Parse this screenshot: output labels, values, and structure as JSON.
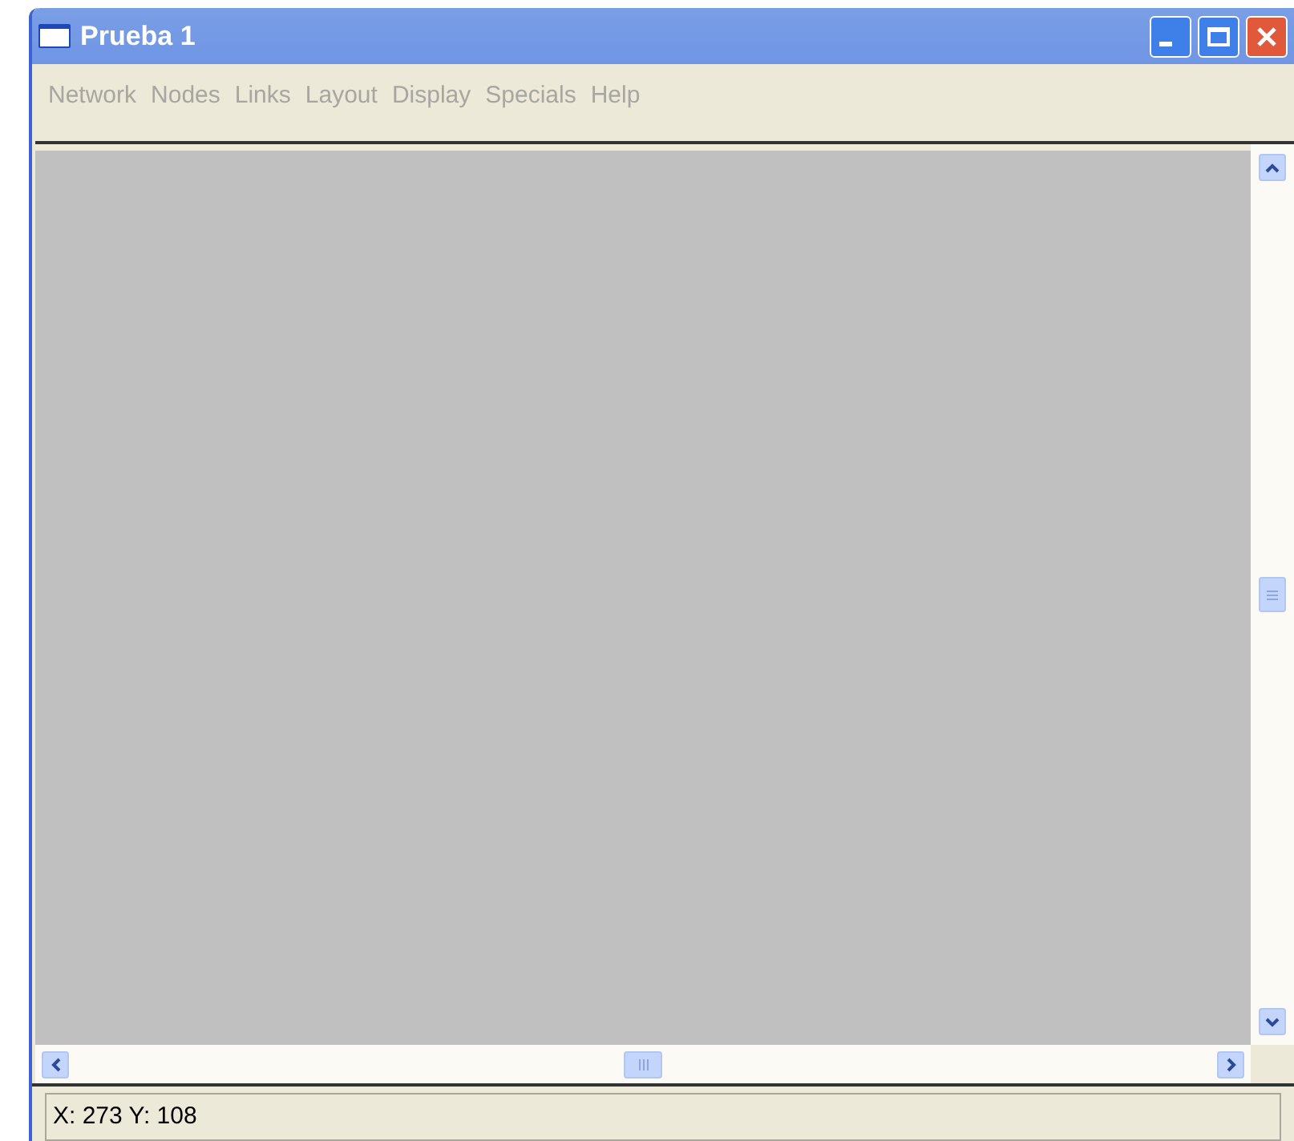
{
  "window": {
    "title": "Prueba 1"
  },
  "menu": [
    {
      "label": "Network",
      "disabled": true
    },
    {
      "label": "Nodes",
      "disabled": true
    },
    {
      "label": "Links",
      "disabled": true
    },
    {
      "label": "Layout",
      "disabled": true
    },
    {
      "label": "Display",
      "disabled": true
    },
    {
      "label": "Specials",
      "disabled": true
    },
    {
      "label": "Help",
      "disabled": true
    }
  ],
  "status_bar": {
    "text": "X: 273 Y: 108"
  }
}
